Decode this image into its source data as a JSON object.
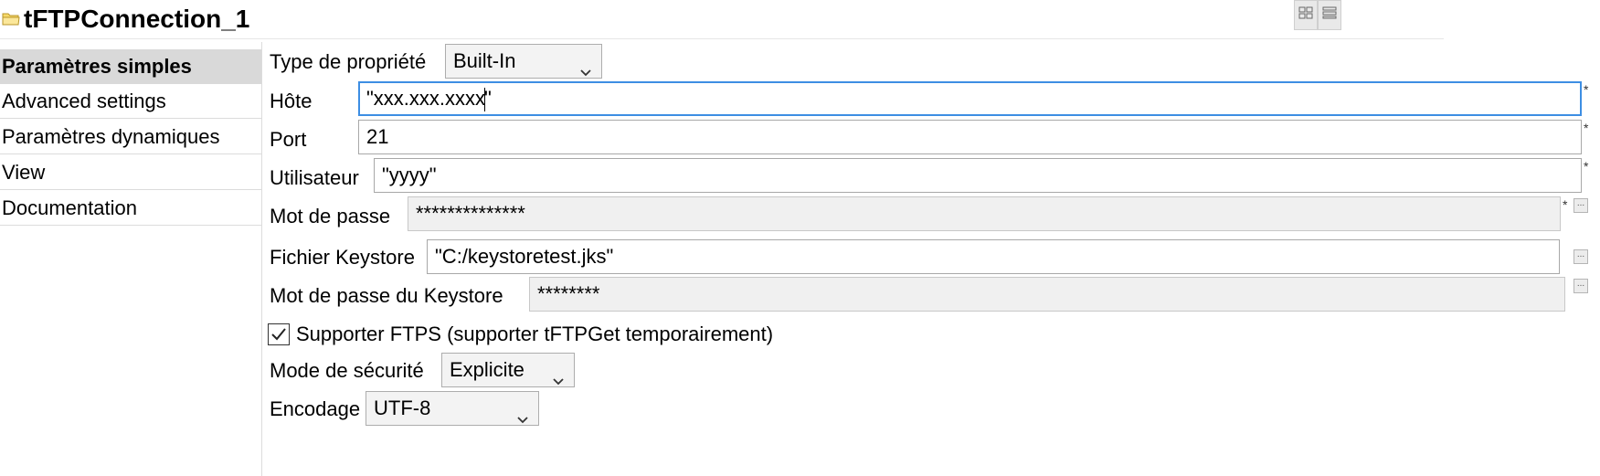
{
  "header": {
    "title": "tFTPConnection_1",
    "icon": "folder-icon",
    "layout_buttons": [
      "grid-layout-icon",
      "list-layout-icon"
    ]
  },
  "sidebar": {
    "items": [
      {
        "label": "Paramètres simples",
        "active": true
      },
      {
        "label": "Advanced settings",
        "active": false
      },
      {
        "label": "Paramètres dynamiques",
        "active": false
      },
      {
        "label": "View",
        "active": false
      },
      {
        "label": "Documentation",
        "active": false
      }
    ]
  },
  "form": {
    "property_type": {
      "label": "Type de propriété",
      "value": "Built-In"
    },
    "host": {
      "label": "Hôte",
      "value_before_caret": "\"xxx.xxx.xxxx",
      "value_after_caret": "\"",
      "required_mark": "*"
    },
    "port": {
      "label": "Port",
      "value": "21",
      "required_mark": "*"
    },
    "user": {
      "label": "Utilisateur",
      "value": "\"yyyy\"",
      "required_mark": "*"
    },
    "password": {
      "label": "Mot de passe",
      "value": "**************",
      "required_mark": "*",
      "button": "..."
    },
    "keystore_file": {
      "label": "Fichier Keystore",
      "value": "\"C:/keystoretest.jks\"",
      "button": "..."
    },
    "keystore_password": {
      "label": "Mot de passe du Keystore",
      "value": "********",
      "button": "..."
    },
    "ftps": {
      "label": "Supporter FTPS (supporter tFTPGet temporairement)",
      "checked": true
    },
    "security_mode": {
      "label": "Mode de sécurité",
      "value": "Explicite"
    },
    "encoding": {
      "label": "Encodage",
      "value": "UTF-8"
    }
  },
  "colors": {
    "focus_border": "#3d8ee3",
    "active_sidebar_bg": "#d9d9d9",
    "readonly_field_bg": "#f0f0f0"
  }
}
